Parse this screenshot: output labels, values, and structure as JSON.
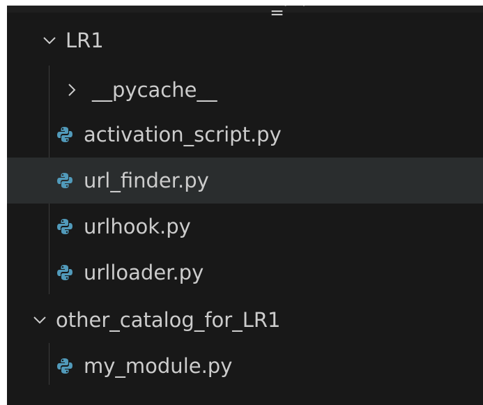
{
  "header": {
    "cropped_title": "‗ᵖ ᵖ"
  },
  "tree": {
    "folder_lr1": {
      "label": "LR1",
      "expanded": true,
      "icon": "chevron-down-icon"
    },
    "items": [
      {
        "label": "__pycache__",
        "type": "folder",
        "expanded": false,
        "icon": "chevron-right-icon"
      },
      {
        "label": "activation_script.py",
        "type": "file",
        "icon": "python-icon"
      },
      {
        "label": "url_finder.py",
        "type": "file",
        "icon": "python-icon",
        "selected": true
      },
      {
        "label": "urlhook.py",
        "type": "file",
        "icon": "python-icon"
      },
      {
        "label": "urlloader.py",
        "type": "file",
        "icon": "python-icon"
      }
    ],
    "folder_other": {
      "label": "other_catalog_for_LR1",
      "expanded": true,
      "icon": "chevron-down-icon"
    },
    "other_items": [
      {
        "label": "my_module.py",
        "type": "file",
        "icon": "python-icon"
      }
    ]
  },
  "colors": {
    "background": "#181818",
    "selected_row": "#2a2d2e",
    "text": "#cccccc",
    "python_icon": "#519aba",
    "indent_guide": "#3c3c3c"
  }
}
